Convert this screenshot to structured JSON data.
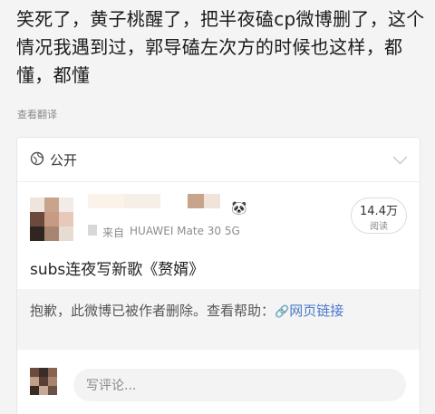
{
  "post": {
    "text": "笑死了，黄子桃醒了，把半夜磕cp微博删了，这个情况我遇到过，郭导磕左次方的时候也这样，都懂，都懂",
    "translate_label": "查看翻译"
  },
  "card": {
    "visibility": "公开",
    "device": "HUAWEI Mate 30 5G",
    "device_prefix": "来自",
    "reads": {
      "value": "14.4万",
      "label": "阅读"
    },
    "title": "subs连夜写新歌《赘婿》",
    "deleted_notice": "抱歉，此微博已被作者删除。查看帮助：",
    "link_text": "网页链接",
    "comment_placeholder": "写评论..."
  },
  "colors": {
    "link": "#4a78c9",
    "background": "#f4f4f4"
  },
  "icons": {
    "visibility": "globe-icon",
    "collapse": "chevron-down-icon",
    "emoji": "panda-icon",
    "link": "link-icon"
  }
}
